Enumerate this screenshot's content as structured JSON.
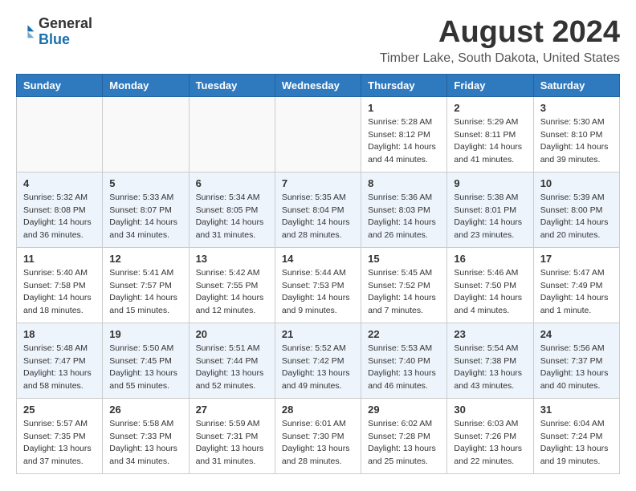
{
  "header": {
    "logo_general": "General",
    "logo_blue": "Blue",
    "month_title": "August 2024",
    "location": "Timber Lake, South Dakota, United States"
  },
  "weekdays": [
    "Sunday",
    "Monday",
    "Tuesday",
    "Wednesday",
    "Thursday",
    "Friday",
    "Saturday"
  ],
  "weeks": [
    [
      {
        "day": "",
        "info": ""
      },
      {
        "day": "",
        "info": ""
      },
      {
        "day": "",
        "info": ""
      },
      {
        "day": "",
        "info": ""
      },
      {
        "day": "1",
        "info": "Sunrise: 5:28 AM\nSunset: 8:12 PM\nDaylight: 14 hours\nand 44 minutes."
      },
      {
        "day": "2",
        "info": "Sunrise: 5:29 AM\nSunset: 8:11 PM\nDaylight: 14 hours\nand 41 minutes."
      },
      {
        "day": "3",
        "info": "Sunrise: 5:30 AM\nSunset: 8:10 PM\nDaylight: 14 hours\nand 39 minutes."
      }
    ],
    [
      {
        "day": "4",
        "info": "Sunrise: 5:32 AM\nSunset: 8:08 PM\nDaylight: 14 hours\nand 36 minutes."
      },
      {
        "day": "5",
        "info": "Sunrise: 5:33 AM\nSunset: 8:07 PM\nDaylight: 14 hours\nand 34 minutes."
      },
      {
        "day": "6",
        "info": "Sunrise: 5:34 AM\nSunset: 8:05 PM\nDaylight: 14 hours\nand 31 minutes."
      },
      {
        "day": "7",
        "info": "Sunrise: 5:35 AM\nSunset: 8:04 PM\nDaylight: 14 hours\nand 28 minutes."
      },
      {
        "day": "8",
        "info": "Sunrise: 5:36 AM\nSunset: 8:03 PM\nDaylight: 14 hours\nand 26 minutes."
      },
      {
        "day": "9",
        "info": "Sunrise: 5:38 AM\nSunset: 8:01 PM\nDaylight: 14 hours\nand 23 minutes."
      },
      {
        "day": "10",
        "info": "Sunrise: 5:39 AM\nSunset: 8:00 PM\nDaylight: 14 hours\nand 20 minutes."
      }
    ],
    [
      {
        "day": "11",
        "info": "Sunrise: 5:40 AM\nSunset: 7:58 PM\nDaylight: 14 hours\nand 18 minutes."
      },
      {
        "day": "12",
        "info": "Sunrise: 5:41 AM\nSunset: 7:57 PM\nDaylight: 14 hours\nand 15 minutes."
      },
      {
        "day": "13",
        "info": "Sunrise: 5:42 AM\nSunset: 7:55 PM\nDaylight: 14 hours\nand 12 minutes."
      },
      {
        "day": "14",
        "info": "Sunrise: 5:44 AM\nSunset: 7:53 PM\nDaylight: 14 hours\nand 9 minutes."
      },
      {
        "day": "15",
        "info": "Sunrise: 5:45 AM\nSunset: 7:52 PM\nDaylight: 14 hours\nand 7 minutes."
      },
      {
        "day": "16",
        "info": "Sunrise: 5:46 AM\nSunset: 7:50 PM\nDaylight: 14 hours\nand 4 minutes."
      },
      {
        "day": "17",
        "info": "Sunrise: 5:47 AM\nSunset: 7:49 PM\nDaylight: 14 hours\nand 1 minute."
      }
    ],
    [
      {
        "day": "18",
        "info": "Sunrise: 5:48 AM\nSunset: 7:47 PM\nDaylight: 13 hours\nand 58 minutes."
      },
      {
        "day": "19",
        "info": "Sunrise: 5:50 AM\nSunset: 7:45 PM\nDaylight: 13 hours\nand 55 minutes."
      },
      {
        "day": "20",
        "info": "Sunrise: 5:51 AM\nSunset: 7:44 PM\nDaylight: 13 hours\nand 52 minutes."
      },
      {
        "day": "21",
        "info": "Sunrise: 5:52 AM\nSunset: 7:42 PM\nDaylight: 13 hours\nand 49 minutes."
      },
      {
        "day": "22",
        "info": "Sunrise: 5:53 AM\nSunset: 7:40 PM\nDaylight: 13 hours\nand 46 minutes."
      },
      {
        "day": "23",
        "info": "Sunrise: 5:54 AM\nSunset: 7:38 PM\nDaylight: 13 hours\nand 43 minutes."
      },
      {
        "day": "24",
        "info": "Sunrise: 5:56 AM\nSunset: 7:37 PM\nDaylight: 13 hours\nand 40 minutes."
      }
    ],
    [
      {
        "day": "25",
        "info": "Sunrise: 5:57 AM\nSunset: 7:35 PM\nDaylight: 13 hours\nand 37 minutes."
      },
      {
        "day": "26",
        "info": "Sunrise: 5:58 AM\nSunset: 7:33 PM\nDaylight: 13 hours\nand 34 minutes."
      },
      {
        "day": "27",
        "info": "Sunrise: 5:59 AM\nSunset: 7:31 PM\nDaylight: 13 hours\nand 31 minutes."
      },
      {
        "day": "28",
        "info": "Sunrise: 6:01 AM\nSunset: 7:30 PM\nDaylight: 13 hours\nand 28 minutes."
      },
      {
        "day": "29",
        "info": "Sunrise: 6:02 AM\nSunset: 7:28 PM\nDaylight: 13 hours\nand 25 minutes."
      },
      {
        "day": "30",
        "info": "Sunrise: 6:03 AM\nSunset: 7:26 PM\nDaylight: 13 hours\nand 22 minutes."
      },
      {
        "day": "31",
        "info": "Sunrise: 6:04 AM\nSunset: 7:24 PM\nDaylight: 13 hours\nand 19 minutes."
      }
    ]
  ]
}
